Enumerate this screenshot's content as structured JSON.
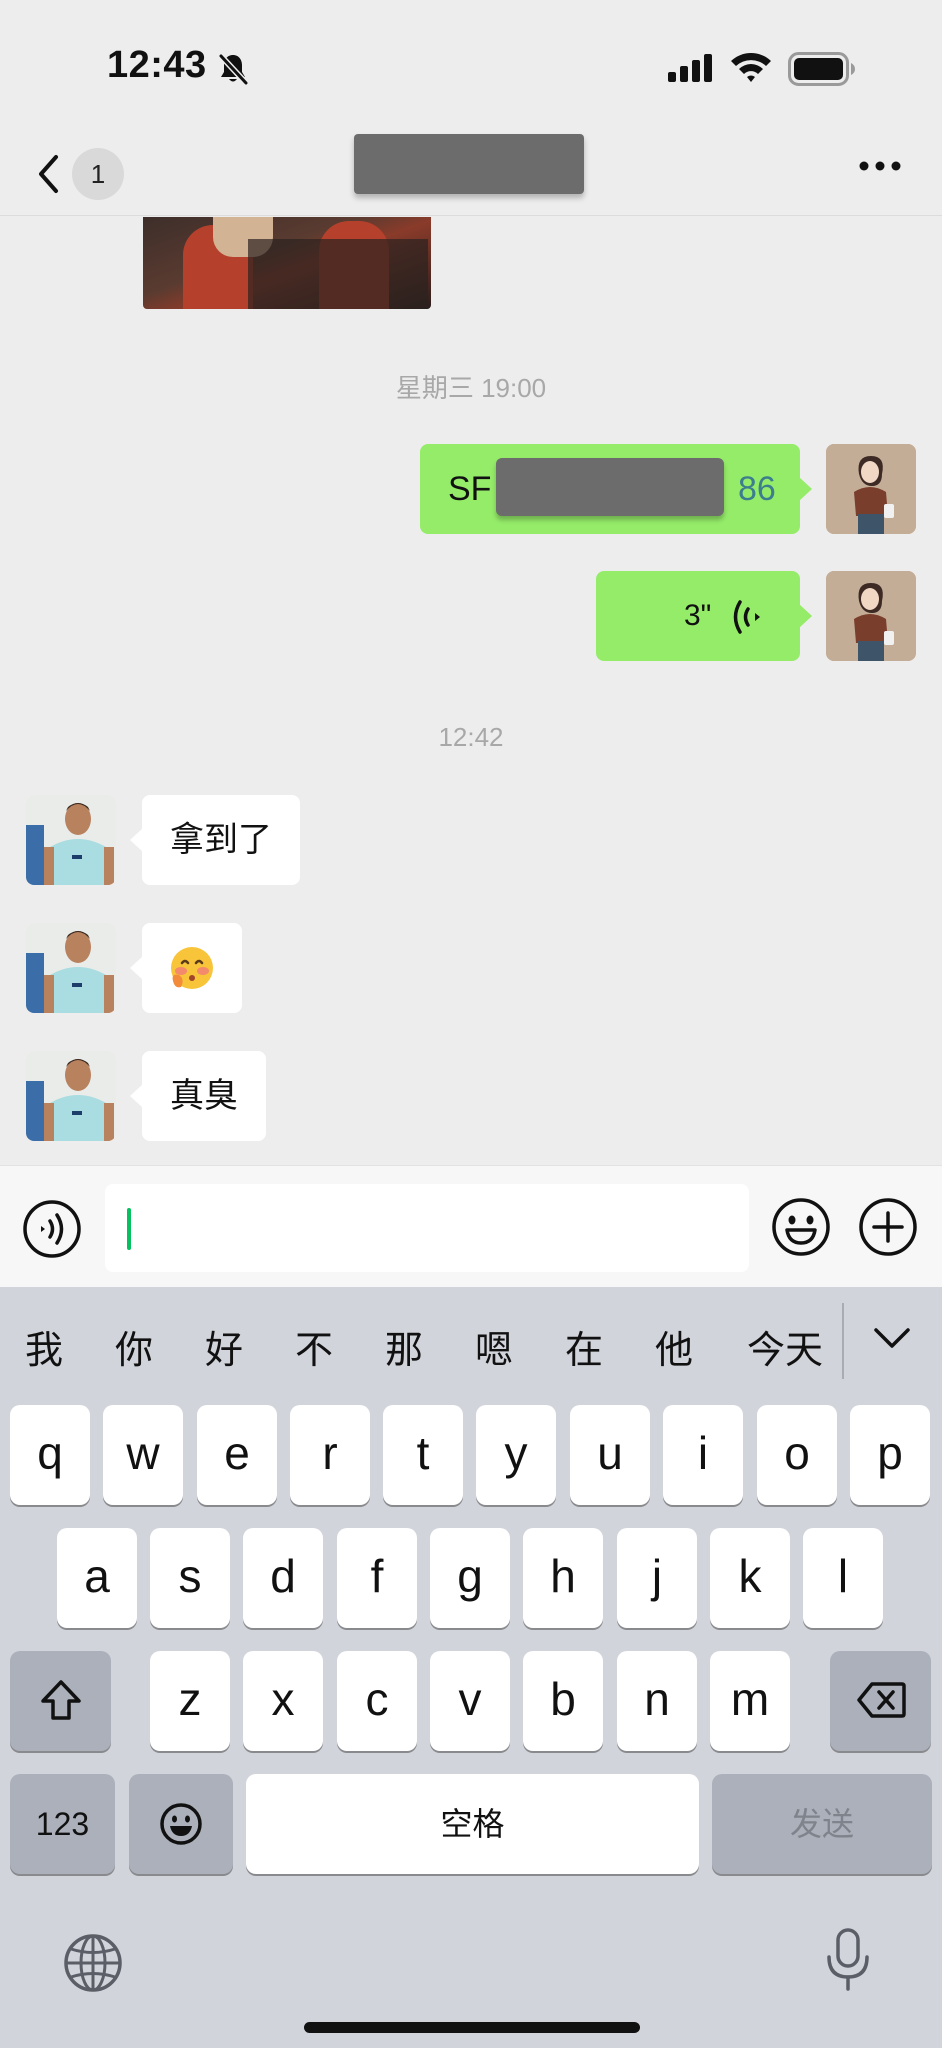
{
  "status_bar": {
    "time": "12:43",
    "icons": [
      "bell-off-icon",
      "signal-icon",
      "wifi-icon",
      "battery-icon"
    ]
  },
  "nav_bar": {
    "unread_count": "1",
    "title_redacted": true,
    "icons": [
      "back-chevron-icon",
      "more-icon"
    ]
  },
  "messages": {
    "timestamp_1": "星期三 19:00",
    "sent_1": {
      "text_start": "SF",
      "text_end": "86",
      "redacted_middle": true
    },
    "sent_2": {
      "duration": "3\""
    },
    "timestamp_2": "12:42",
    "received_1": {
      "text": "拿到了"
    },
    "received_2": {
      "emoji": "🥰"
    },
    "received_3": {
      "text": "真臭"
    }
  },
  "input_bar": {
    "value": "",
    "icons": [
      "voice-icon",
      "emoji-icon",
      "plus-icon"
    ]
  },
  "keyboard": {
    "candidates": [
      "我",
      "你",
      "好",
      "不",
      "那",
      "嗯",
      "在",
      "他",
      "今天"
    ],
    "row1": [
      "q",
      "w",
      "e",
      "r",
      "t",
      "y",
      "u",
      "i",
      "o",
      "p"
    ],
    "row2": [
      "a",
      "s",
      "d",
      "f",
      "g",
      "h",
      "j",
      "k",
      "l"
    ],
    "row3": [
      "z",
      "x",
      "c",
      "v",
      "b",
      "n",
      "m"
    ],
    "numbers_label": "123",
    "space_label": "空格",
    "send_label": "发送"
  },
  "colors": {
    "sent_bubble": "#95ec69",
    "received_bubble": "#ffffff",
    "chat_background": "#ededed",
    "caret": "#07c160",
    "keyboard_background": "#d1d4db",
    "link_teal": "#3c7e8e"
  }
}
